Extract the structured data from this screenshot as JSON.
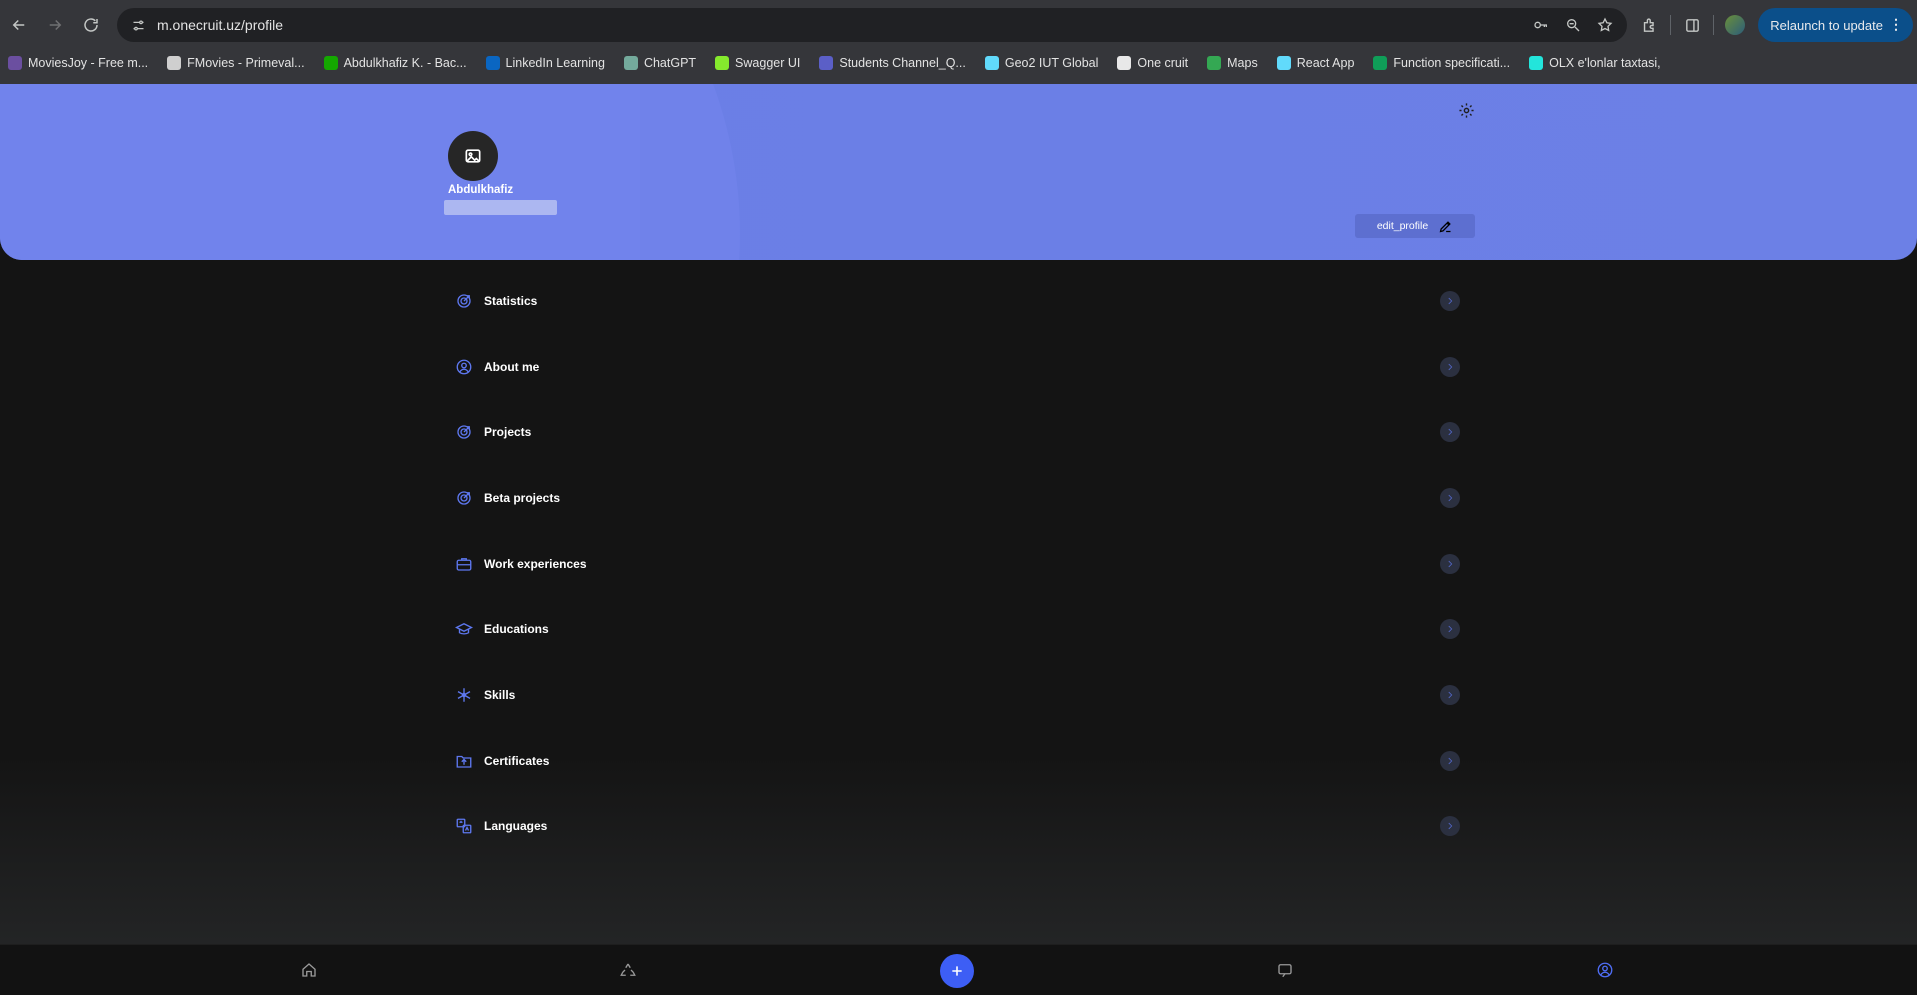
{
  "browser": {
    "url": "m.onecruit.uz/profile",
    "relaunch_label": "Relaunch to update",
    "bookmarks": [
      {
        "label": "MoviesJoy - Free m...",
        "color": "#6b4fa0"
      },
      {
        "label": "FMovies - Primeval...",
        "color": "#cfcfcf"
      },
      {
        "label": "Abdulkhafiz K. - Bac...",
        "color": "#14a800"
      },
      {
        "label": "LinkedIn Learning",
        "color": "#0a66c2"
      },
      {
        "label": "ChatGPT",
        "color": "#74aa9c"
      },
      {
        "label": "Swagger UI",
        "color": "#85ea2d"
      },
      {
        "label": "Students Channel_Q...",
        "color": "#5b5fc7"
      },
      {
        "label": "Geo2 IUT Global",
        "color": "#61dafb"
      },
      {
        "label": "One cruit",
        "color": "#e8e8e8"
      },
      {
        "label": "Maps",
        "color": "#34a853"
      },
      {
        "label": "React App",
        "color": "#61dafb"
      },
      {
        "label": "Function specificati...",
        "color": "#0f9d58"
      },
      {
        "label": "OLX e'lonlar taxtasi,",
        "color": "#23e5db"
      }
    ]
  },
  "profile": {
    "name": "Abdulkhafiz",
    "edit_label": "edit_profile"
  },
  "menu": [
    {
      "label": "Statistics",
      "icon": "target-icon"
    },
    {
      "label": "About me",
      "icon": "user-circle-icon"
    },
    {
      "label": "Projects",
      "icon": "target-icon"
    },
    {
      "label": "Beta projects",
      "icon": "target-icon"
    },
    {
      "label": "Work experiences",
      "icon": "briefcase-icon"
    },
    {
      "label": "Educations",
      "icon": "graduation-cap-icon"
    },
    {
      "label": "Skills",
      "icon": "snowflake-icon"
    },
    {
      "label": "Certificates",
      "icon": "upload-folder-icon"
    },
    {
      "label": "Languages",
      "icon": "translate-icon"
    }
  ],
  "colors": {
    "hero": "#6b7fe6",
    "accent": "#3d5ef5",
    "background": "#141414"
  }
}
